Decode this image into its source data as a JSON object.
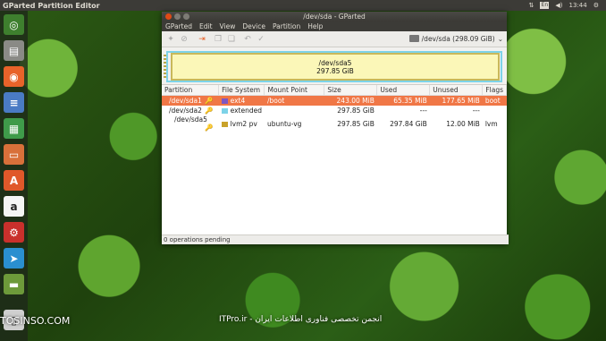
{
  "topbar": {
    "title": "GParted Partition Editor",
    "lang": "En",
    "time": "13:44"
  },
  "window": {
    "title": "/dev/sda - GParted"
  },
  "menu": [
    "GParted",
    "Edit",
    "View",
    "Device",
    "Partition",
    "Help"
  ],
  "device": {
    "selector": "/dev/sda  (298.09 GiB)"
  },
  "disk_map": {
    "name": "/dev/sda5",
    "size": "297.85 GiB"
  },
  "columns": [
    "Partition",
    "File System",
    "Mount Point",
    "Size",
    "Used",
    "Unused",
    "Flags"
  ],
  "rows": [
    {
      "partition": "/dev/sda1",
      "fs": "ext4",
      "fs_color": "#7e57c2",
      "mount": "/boot",
      "size": "243.00 MiB",
      "used": "65.35 MiB",
      "unused": "177.65 MiB",
      "flags": "boot",
      "selected": true
    },
    {
      "partition": "/dev/sda2",
      "fs": "extended",
      "fs_color": "#7dd3e8",
      "mount": "",
      "size": "297.85 GiB",
      "used": "---",
      "unused": "---",
      "flags": "",
      "selected": false
    },
    {
      "partition": "/dev/sda5",
      "fs": "lvm2 pv",
      "fs_color": "#c9a22a",
      "mount": "ubuntu-vg",
      "size": "297.85 GiB",
      "used": "297.84 GiB",
      "unused": "12.00 MiB",
      "flags": "lvm",
      "selected": false
    }
  ],
  "status": "0 operations pending",
  "watermark": {
    "left": "TOSINSO.COM",
    "right": "ITPro.ir - انجمن تخصصی فناوری اطلاعات ایران"
  }
}
